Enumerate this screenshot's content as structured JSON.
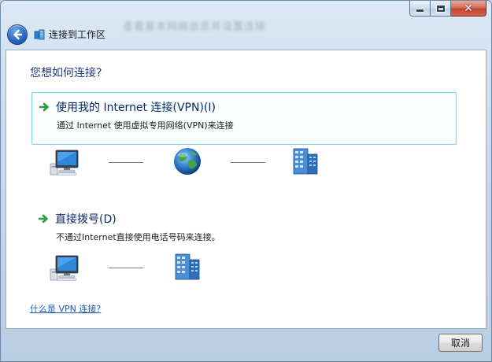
{
  "window": {
    "background_title": "查看基本网络信息并设置连接",
    "nav_title": "连接到工作区",
    "controls": {
      "minimize": "minimize-icon",
      "maximize": "maximize-icon",
      "close": "close-icon"
    }
  },
  "content": {
    "heading": "您想如何连接?",
    "options": [
      {
        "title": "使用我的 Internet 连接(VPN)(I)",
        "description": "通过 Internet 使用虚拟专用网络(VPN)来连接",
        "icon": "arrow-right-icon",
        "highlighted": true,
        "diagram": [
          "computer-icon",
          "globe-icon",
          "server-icon"
        ]
      },
      {
        "title": "直接拨号(D)",
        "description": "不通过Internet直接使用电话号码来连接。",
        "icon": "arrow-right-icon",
        "highlighted": false,
        "diagram": [
          "computer-icon",
          "server-icon"
        ]
      }
    ],
    "help_link": "什么是 VPN 连接?"
  },
  "footer": {
    "cancel_label": "取消"
  },
  "colors": {
    "heading": "#1c3a7b",
    "link": "#1d5bb4",
    "highlight_border": "#7fd1f0",
    "arrow": "#2e9c3a"
  }
}
